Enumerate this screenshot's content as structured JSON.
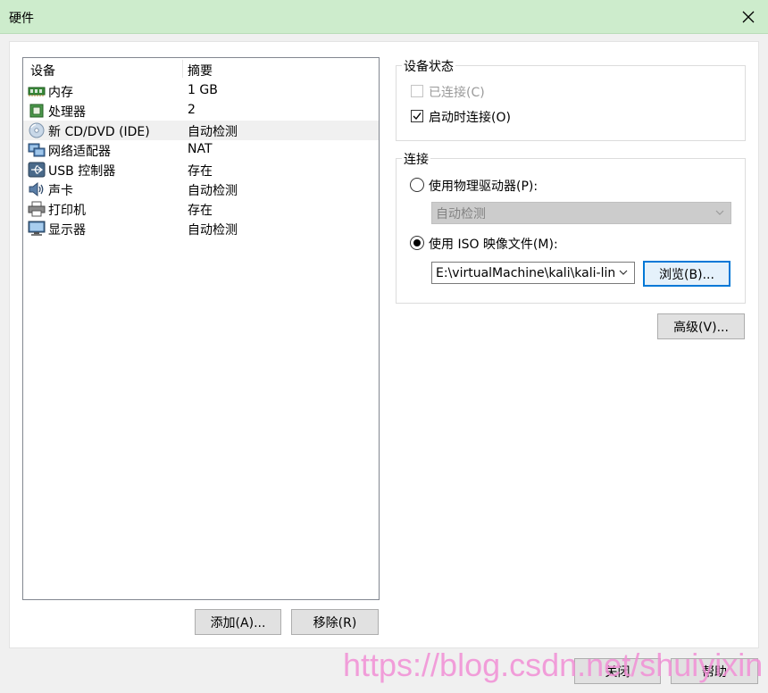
{
  "window": {
    "title": "硬件"
  },
  "device_list": {
    "headers": {
      "device": "设备",
      "summary": "摘要"
    },
    "rows": [
      {
        "name": "内存",
        "summary": "1 GB",
        "icon": "memory-icon"
      },
      {
        "name": "处理器",
        "summary": "2",
        "icon": "processor-icon"
      },
      {
        "name": "新 CD/DVD (IDE)",
        "summary": "自动检测",
        "icon": "cd-dvd-icon",
        "selected": true
      },
      {
        "name": "网络适配器",
        "summary": "NAT",
        "icon": "network-adapter-icon"
      },
      {
        "name": "USB 控制器",
        "summary": "存在",
        "icon": "usb-icon"
      },
      {
        "name": "声卡",
        "summary": "自动检测",
        "icon": "sound-card-icon"
      },
      {
        "name": "打印机",
        "summary": "存在",
        "icon": "printer-icon"
      },
      {
        "name": "显示器",
        "summary": "自动检测",
        "icon": "display-icon"
      }
    ]
  },
  "buttons": {
    "add": "添加(A)...",
    "remove": "移除(R)",
    "browse": "浏览(B)...",
    "advanced": "高级(V)...",
    "close": "关闭",
    "help": "帮助"
  },
  "device_status": {
    "title": "设备状态",
    "connected": {
      "label": "已连接(C)",
      "checked": false,
      "disabled": true
    },
    "connect_on_power_on": {
      "label": "启动时连接(O)",
      "checked": true
    }
  },
  "connection": {
    "title": "连接",
    "physical": {
      "label": "使用物理驱动器(P):",
      "selected": false,
      "dropdown_value": "自动检测"
    },
    "iso": {
      "label": "使用 ISO 映像文件(M):",
      "selected": true,
      "path": "E:\\virtualMachine\\kali\\kali-linux-"
    }
  },
  "watermark": "https://blog.csdn.net/shuiyixin",
  "colors": {
    "titlebar": "#cdeccc",
    "focus_border": "#0078d7",
    "selection": "#f0f0f0",
    "watermark": "#f28fd6"
  }
}
